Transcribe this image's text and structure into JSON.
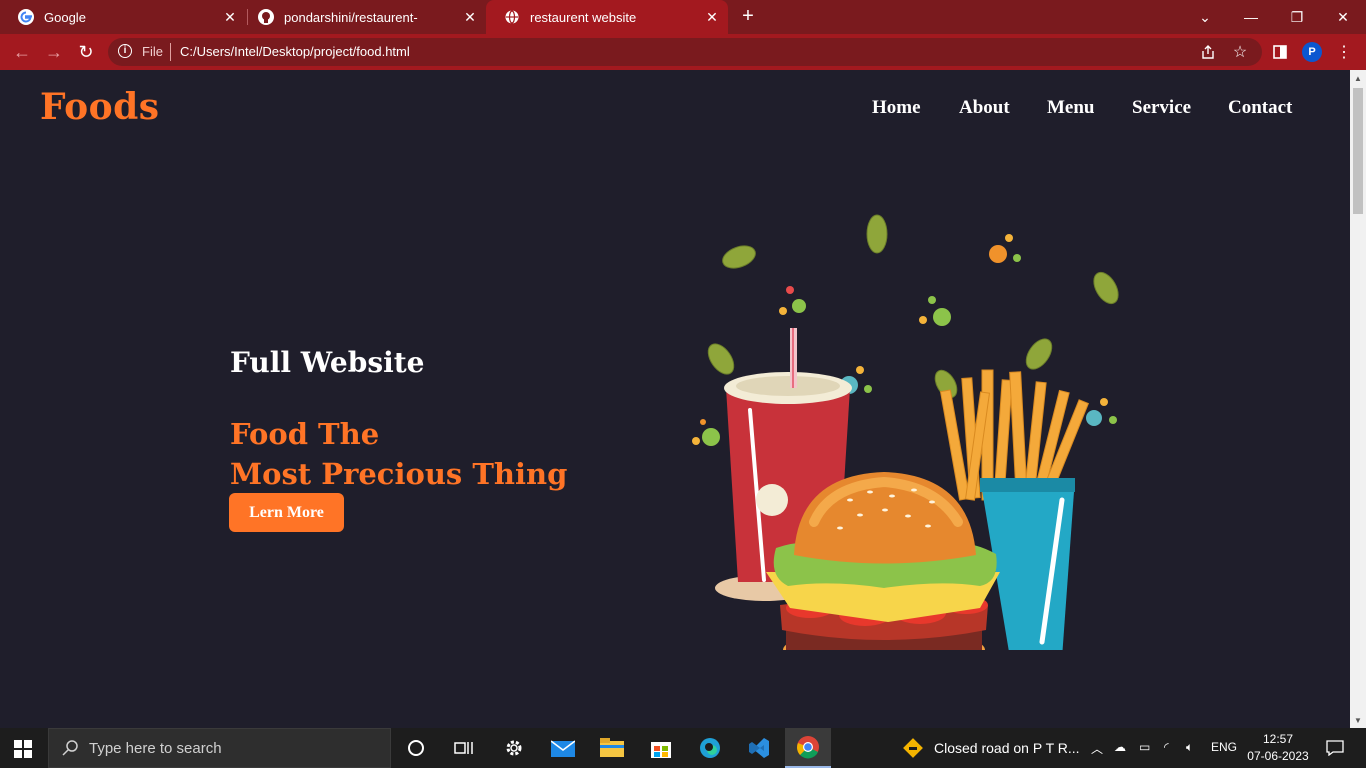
{
  "browser": {
    "tabs": [
      {
        "label": "Google",
        "icon": "google-icon"
      },
      {
        "label": "pondarshini/restaurent-",
        "icon": "github-icon"
      },
      {
        "label": "restaurent website",
        "icon": "globe-icon"
      }
    ],
    "active_tab": 2,
    "omnibox": {
      "scheme_label": "File",
      "url": "C:/Users/Intel/Desktop/project/food.html"
    },
    "profile_initial": "P"
  },
  "site": {
    "logo": "Foods",
    "nav": [
      "Home",
      "About",
      "Menu",
      "Service",
      "Contact"
    ],
    "hero": {
      "subtitle": "Full Website",
      "title_line1": "Food The",
      "title_line2": "Most Precious Thing",
      "button": "Lern More"
    }
  },
  "taskbar": {
    "search_placeholder": "Type here to search",
    "news": "Closed road on P T R...",
    "language": "ENG",
    "time": "12:57",
    "date": "07-06-2023"
  },
  "colors": {
    "accent": "#ff7426",
    "page_bg": "#1f1e2b",
    "chrome_dark": "#7a1a1e",
    "chrome_light": "#a3191f"
  }
}
